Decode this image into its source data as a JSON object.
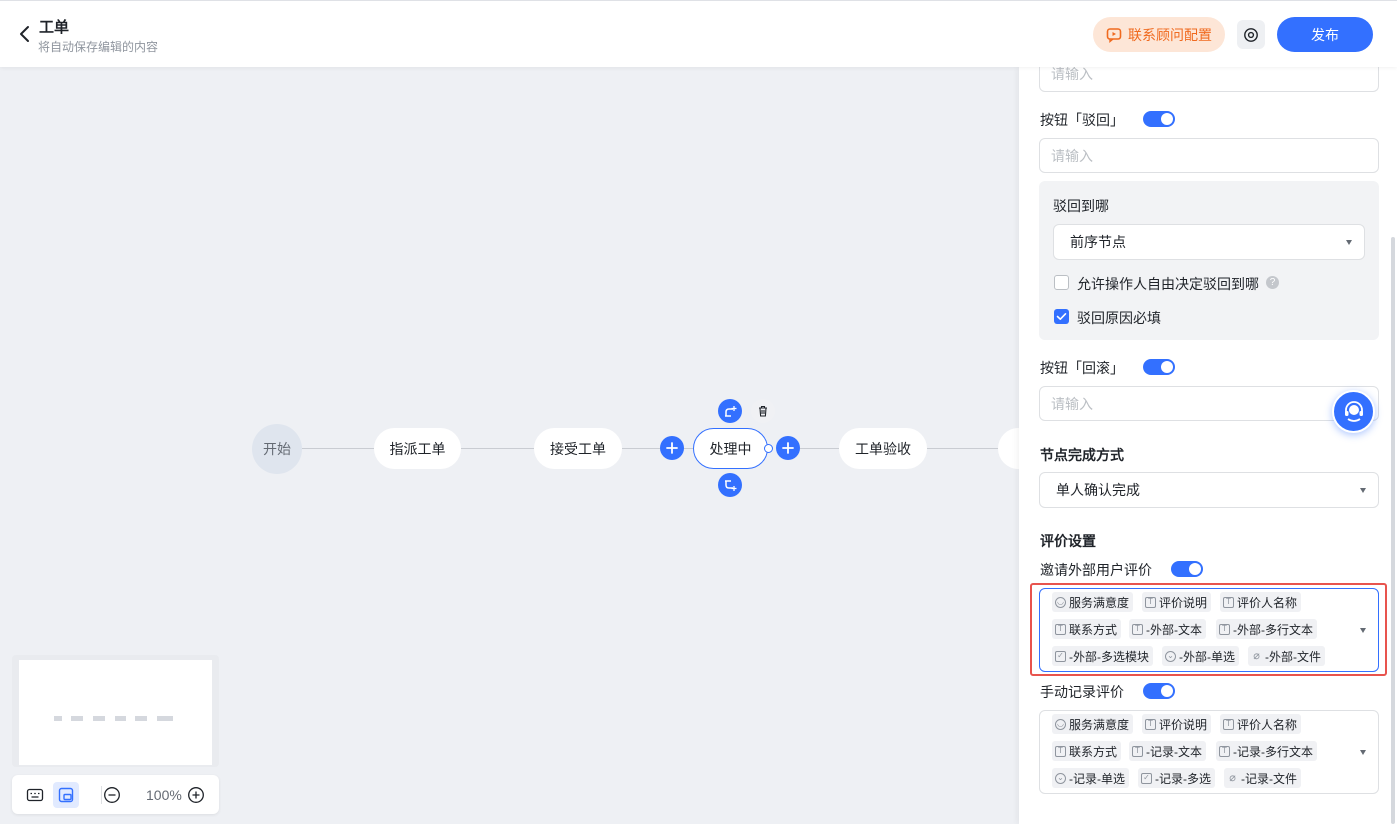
{
  "header": {
    "title": "工单",
    "subtitle": "将自动保存编辑的内容",
    "consult_label": "联系顾问配置",
    "publish_label": "发布"
  },
  "colors": {
    "accent": "#3370ff",
    "consult_bg": "#fde6d7",
    "consult_text": "#f06a1f",
    "highlight": "#e8544e"
  },
  "flow": {
    "start": "开始",
    "nodes": [
      "指派工单",
      "接受工单",
      "处理中",
      "工单验收"
    ],
    "active_node": "处理中"
  },
  "zoom": {
    "level": "100%"
  },
  "panel": {
    "top_input_placeholder": "请输入",
    "reject_button_label": "按钮「驳回」",
    "reject_input_placeholder": "请输入",
    "reject_to_label": "驳回到哪",
    "reject_to_value": "前序节点",
    "allow_free_choice_label": "允许操作人自由决定驳回到哪",
    "allow_free_choice_checked": false,
    "reason_required_label": "驳回原因必填",
    "reason_required_checked": true,
    "rollback_button_label": "按钮「回滚」",
    "rollback_input_placeholder": "请输入",
    "completion_title": "节点完成方式",
    "completion_value": "单人确认完成",
    "evaluation_title": "评价设置",
    "invite_external_label": "邀请外部用户评价",
    "invite_external_tags": [
      [
        "服务满意度",
        "评价说明",
        "评价人名称"
      ],
      [
        "联系方式",
        "-外部-文本",
        "-外部-多行文本"
      ],
      [
        "-外部-多选模块",
        "-外部-单选",
        "-外部-文件"
      ]
    ],
    "manual_record_label": "手动记录评价",
    "manual_record_tags": [
      [
        "服务满意度",
        "评价说明",
        "评价人名称"
      ],
      [
        "联系方式",
        "-记录-文本",
        "-记录-多行文本"
      ],
      [
        "-记录-单选",
        "-记录-多选",
        "-记录-文件"
      ]
    ]
  }
}
